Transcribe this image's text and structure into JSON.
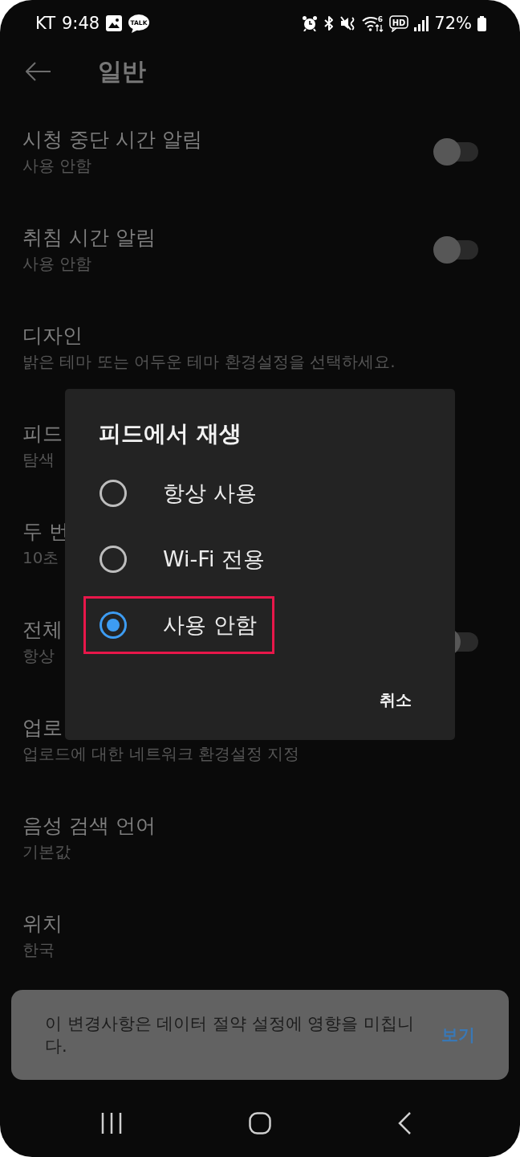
{
  "status_bar": {
    "carrier": "KT",
    "time": "9:48",
    "talk_label": "TALK",
    "wifi_label": "6",
    "hd_label": "HD",
    "battery": "72%"
  },
  "header": {
    "title": "일반"
  },
  "settings": [
    {
      "title": "시청 중단 시간 알림",
      "subtitle": "사용 안함",
      "kind": "toggle",
      "on": false
    },
    {
      "title": "취침 시간 알림",
      "subtitle": "사용 안함",
      "kind": "toggle",
      "on": false
    },
    {
      "title": "디자인",
      "subtitle": "밝은 테마 또는 어두운 테마 환경설정을 선택하세요.",
      "kind": "text"
    },
    {
      "title": "피드",
      "subtitle": "탐색",
      "kind": "text"
    },
    {
      "title": "두 번",
      "subtitle": "10초",
      "kind": "text"
    },
    {
      "title": "전체",
      "subtitle": "항상",
      "kind": "toggle",
      "on": false
    },
    {
      "title": "업로",
      "subtitle": "업로드에 대한 네트워크 환경설정 지정",
      "kind": "text"
    },
    {
      "title": "음성 검색 언어",
      "subtitle": "기본값",
      "kind": "text"
    },
    {
      "title": "위치",
      "subtitle": "한국",
      "kind": "text"
    }
  ],
  "dialog": {
    "title": "피드에서 재생",
    "options": [
      {
        "label": "항상 사용",
        "selected": false,
        "highlighted": false
      },
      {
        "label": "Wi-Fi 전용",
        "selected": false,
        "highlighted": false
      },
      {
        "label": "사용 안함",
        "selected": true,
        "highlighted": true
      }
    ],
    "cancel": "취소"
  },
  "snackbar": {
    "message": "이 변경사항은 데이터 절약 설정에 영향을 미칩니다.",
    "action": "보기"
  }
}
